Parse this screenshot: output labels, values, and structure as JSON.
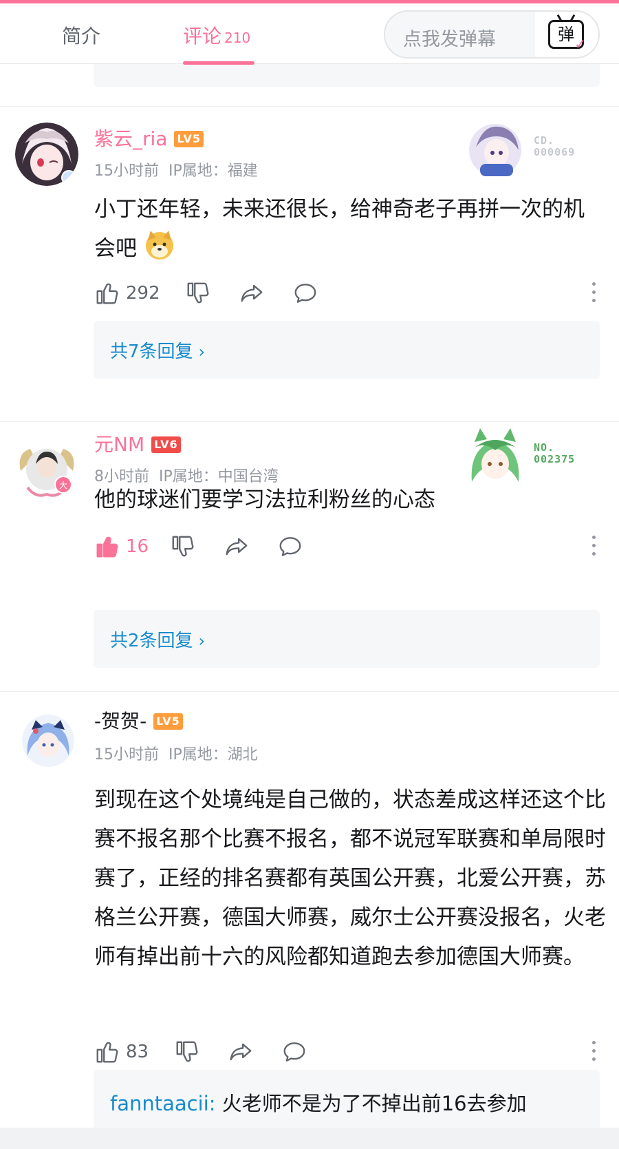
{
  "header": {
    "tab_intro": "简介",
    "tab_comments": "评论",
    "comment_count": "210",
    "danmaku_placeholder": "点我发弹幕",
    "danmaku_button": "弹"
  },
  "colors": {
    "accent": "#fb7299",
    "link": "#178bcf",
    "muted": "#9499a0"
  },
  "comments": [
    {
      "username": "紫云_ria",
      "level": "LV5",
      "time": "15小时前",
      "ip": "IP属地：福建",
      "content": "小丁还年轻，未来还很长，给神奇老子再拼一次的机会吧",
      "emoji": "doge-emoji",
      "likes": "292",
      "liked": false,
      "replies": "共7条回复",
      "badge_no": [
        "CD.",
        "000069"
      ]
    },
    {
      "username": "元NM",
      "level": "LV6",
      "time": "8小时前",
      "ip": "IP属地：中国台湾",
      "content": "他的球迷们要学习法拉利粉丝的心态",
      "likes": "16",
      "liked": true,
      "replies": "共2条回复",
      "badge_no": [
        "NO.",
        "002375"
      ]
    },
    {
      "username": "-贺贺-",
      "level": "LV5",
      "time": "15小时前",
      "ip": "IP属地：湖北",
      "content": "到现在这个处境纯是自己做的，状态差成这样还这个比赛不报名那个比赛不报名，都不说冠军联赛和单局限时赛了，正经的排名赛都有英国公开赛，北爱公开赛，苏格兰公开赛，德国大师赛，威尔士公开赛没报名，火老师有掉出前十六的风险都知道跑去参加德国大师赛。",
      "likes": "83",
      "liked": false,
      "reply_preview": {
        "name": "fanntaacii",
        "text": "火老师不是为了不掉出前16去参加"
      }
    }
  ]
}
